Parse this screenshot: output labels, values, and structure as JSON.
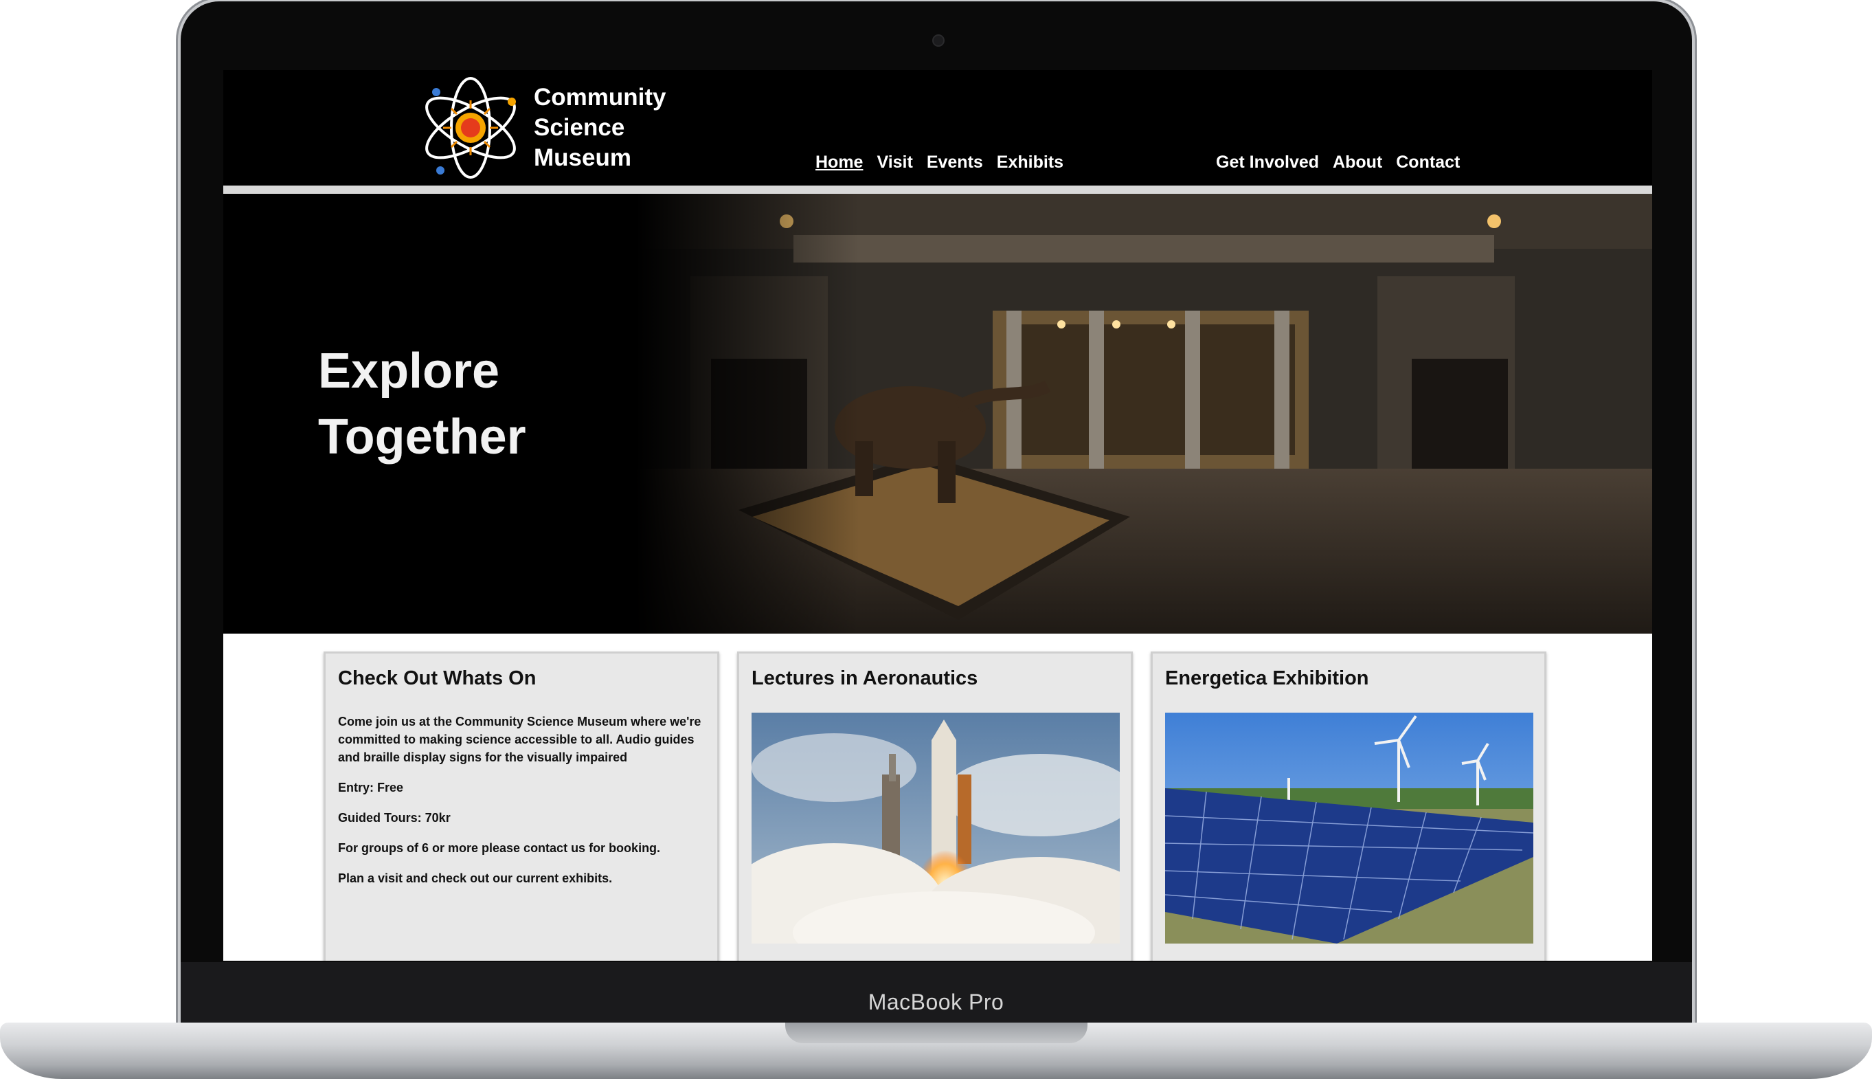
{
  "device": {
    "brand_label": "MacBook Pro"
  },
  "site": {
    "logo_lines": [
      "Community",
      "Science",
      "Museum"
    ],
    "nav_left": [
      {
        "label": "Home",
        "active": true
      },
      {
        "label": "Visit",
        "active": false
      },
      {
        "label": "Events",
        "active": false
      },
      {
        "label": "Exhibits",
        "active": false
      }
    ],
    "nav_right": [
      {
        "label": "Get Involved"
      },
      {
        "label": "About"
      },
      {
        "label": "Contact"
      }
    ]
  },
  "hero": {
    "title_line1": "Explore",
    "title_line2": "Together"
  },
  "cards": [
    {
      "title": "Check Out Whats On",
      "paragraphs": [
        "Come join us at the Community Science Museum where we're committed to making science accessible to all. Audio guides and braille display signs for the visually impaired",
        "Entry: Free",
        "Guided Tours: 70kr",
        "For groups of 6 or more please contact us for booking.",
        "Plan a visit and check out our current exhibits."
      ]
    },
    {
      "title": "Lectures in Aeronautics"
    },
    {
      "title": "Energetica Exhibition"
    }
  ],
  "colors": {
    "header_bg": "#000000",
    "header_rule": "#d9d9d9",
    "card_bg": "#e8e8e8",
    "sun": "#f5a400"
  }
}
